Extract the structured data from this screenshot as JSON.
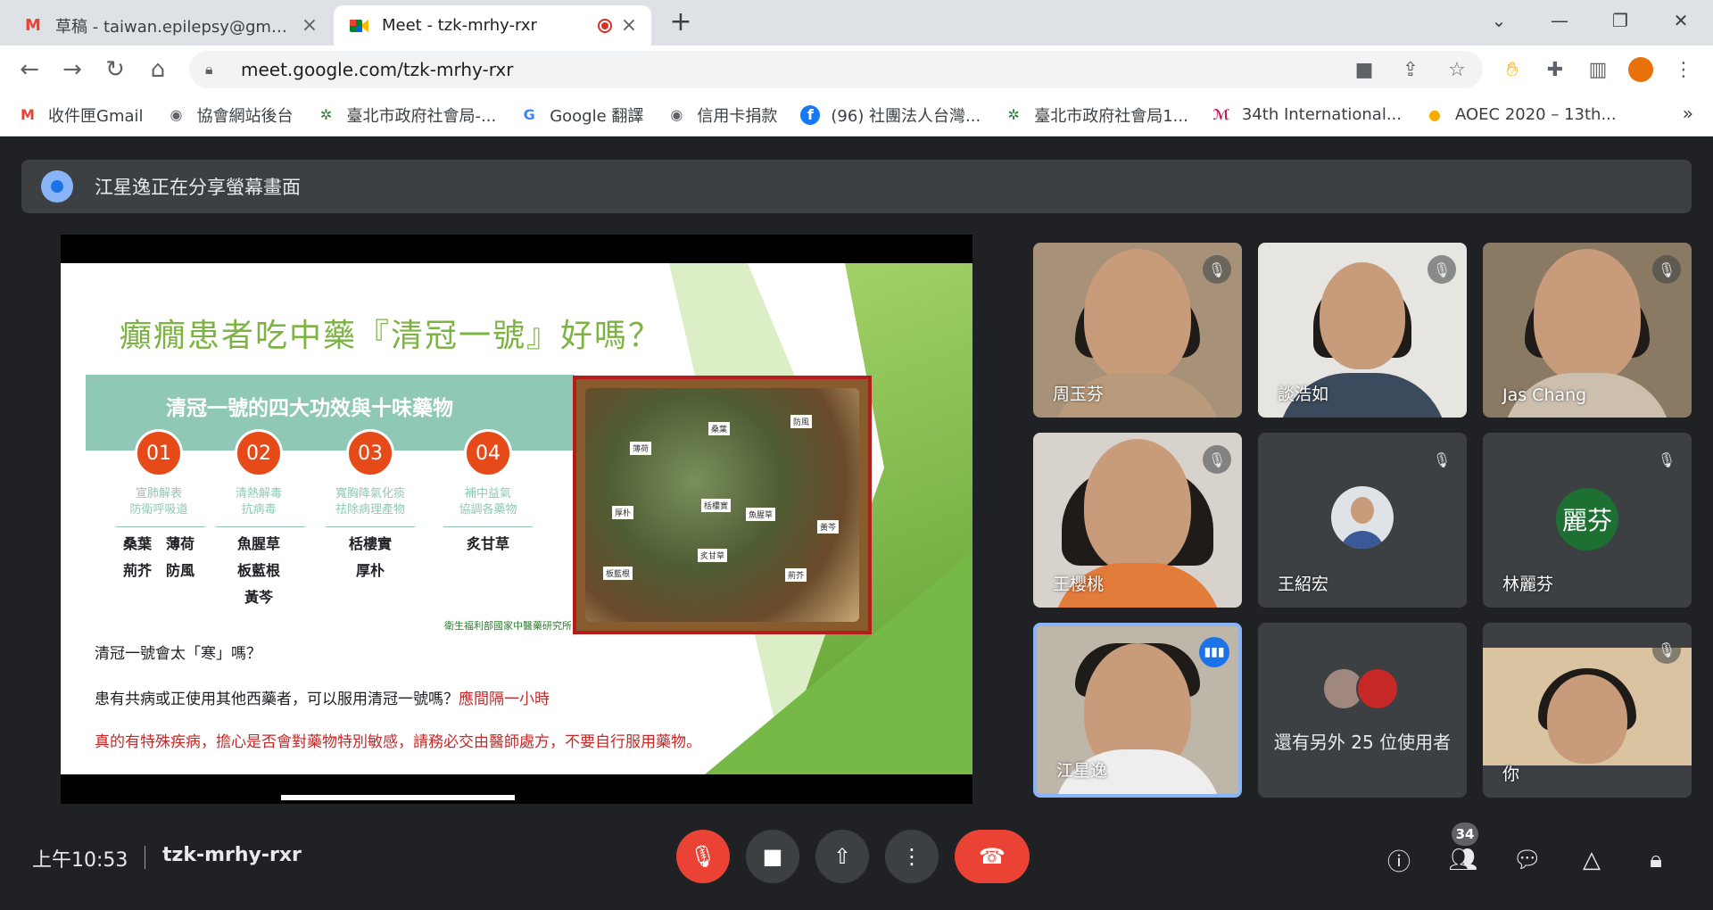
{
  "browser": {
    "tabs": [
      {
        "title": "草稿 - taiwan.epilepsy@gmail.c",
        "favicon": "gmail-icon",
        "active": false
      },
      {
        "title": "Meet - tzk-mrhy-rxr",
        "favicon": "google-meet-icon",
        "active": true,
        "recording": true
      }
    ],
    "url": "meet.google.com/tzk-mrhy-rxr",
    "bookmarks": [
      {
        "label": "收件匣Gmail",
        "icon": "gmail-icon"
      },
      {
        "label": "協會網站後台",
        "icon": "globe-icon"
      },
      {
        "label": "臺北市政府社會局-...",
        "icon": "taipei-icon"
      },
      {
        "label": "Google 翻譯",
        "icon": "translate-icon"
      },
      {
        "label": "信用卡捐款",
        "icon": "globe-icon"
      },
      {
        "label": "(96) 社團法人台灣...",
        "icon": "facebook-icon"
      },
      {
        "label": "臺北市政府社會局1...",
        "icon": "taipei-icon"
      },
      {
        "label": "34th International...",
        "icon": "conference-icon"
      },
      {
        "label": "AOEC 2020 – 13th...",
        "icon": "aoec-icon"
      }
    ],
    "bookmarks_more": "»"
  },
  "meet": {
    "banner_text": "江星逸正在分享螢幕畫面",
    "slide": {
      "title": "癲癇患者吃中藥『清冠一號』好嗎？",
      "band_title": "清冠一號的四大功效與十味藥物",
      "steps": [
        {
          "num": "01",
          "line1": "宣肺解表",
          "line2": "防衛呼吸道",
          "herbs": [
            "桑葉　薄荷",
            "荊芥　防風"
          ]
        },
        {
          "num": "02",
          "line1": "清熱解毒",
          "line2": "抗病毒",
          "herbs": [
            "魚腥草",
            "板藍根",
            "黃芩"
          ]
        },
        {
          "num": "03",
          "line1": "寬胸降氣化痰",
          "line2": "祛除病理產物",
          "herbs": [
            "栝樓實",
            "厚朴"
          ]
        },
        {
          "num": "04",
          "line1": "補中益氣",
          "line2": "協調各藥物",
          "herbs": [
            "炙甘草"
          ]
        }
      ],
      "tray_tags": [
        "桑葉",
        "薄荷",
        "防風",
        "厚朴",
        "栝樓實",
        "魚腥草",
        "黃芩",
        "炙甘草",
        "荊芥",
        "板藍根"
      ],
      "logo_text": "衛生福利部國家中醫藥研究所",
      "q1": "清冠一號會太「寒」嗎？",
      "q2_black": "患有共病或正使用其他西藥者，可以服用清冠一號嗎？",
      "q2_red": "應間隔一小時",
      "q3": "真的有特殊疾病，擔心是否會對藥物特別敏感，請務必交由醫師處方，不要自行服用藥物。"
    },
    "participants": [
      {
        "name": "周玉芬",
        "type": "video",
        "muted": true
      },
      {
        "name": "談浩如",
        "type": "video",
        "muted": true
      },
      {
        "name": "Jas Chang",
        "type": "video",
        "muted": true
      },
      {
        "name": "王櫻桃",
        "type": "video",
        "muted": true
      },
      {
        "name": "王紹宏",
        "type": "avatar",
        "muted": true
      },
      {
        "name": "林麗芬",
        "type": "initial",
        "initial": "麗芬",
        "muted": true
      },
      {
        "name": "江星逸",
        "type": "video",
        "muted": false,
        "speaking": true
      },
      {
        "name": "還有另外 25 位使用者",
        "type": "others"
      },
      {
        "name": "你",
        "type": "video",
        "muted": true
      }
    ],
    "time": "上午10:53",
    "meeting_code": "tzk-mrhy-rxr",
    "people_count": "34",
    "colors": {
      "accent": "#8ab4f8",
      "danger": "#ea4335",
      "slide_green": "#7cb342",
      "band": "#8fc8b4",
      "circle": "#e64a19"
    }
  }
}
